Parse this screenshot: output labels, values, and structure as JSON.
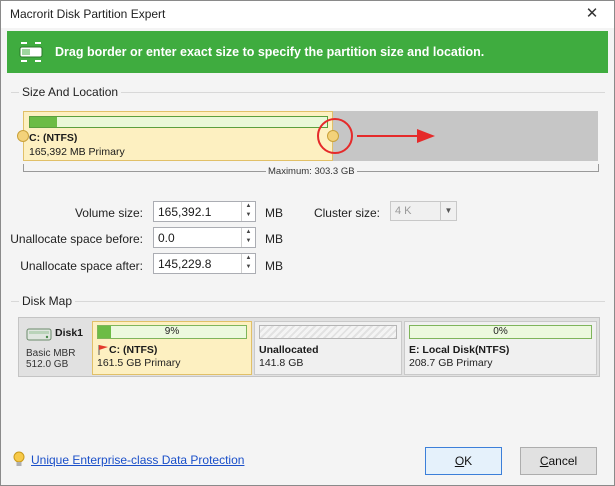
{
  "window": {
    "title": "Macrorit Disk Partition Expert",
    "close_glyph": "✕"
  },
  "banner": {
    "text": "Drag border or enter exact size to specify the partition size and location."
  },
  "size_location": {
    "group_label": "Size And Location",
    "partition_name": "C: (NTFS)",
    "partition_info": "165,392 MB Primary",
    "used_fraction": 0.09,
    "maximum_label": "Maximum: 303.3 GB"
  },
  "form": {
    "volume_size": {
      "label": "Volume size:",
      "value": "165,392.1",
      "unit": "MB"
    },
    "unalloc_before": {
      "label": "Unallocate space before:",
      "value": "0.0",
      "unit": "MB"
    },
    "unalloc_after": {
      "label": "Unallocate space after:",
      "value": "145,229.8",
      "unit": "MB"
    },
    "cluster_size": {
      "label": "Cluster size:",
      "value": "4 K"
    }
  },
  "disk_map": {
    "group_label": "Disk Map",
    "disk": {
      "name": "Disk1",
      "type": "Basic MBR",
      "size": "512.0 GB"
    },
    "segments": [
      {
        "pct": "9%",
        "fill": 0.09,
        "name": "C: (NTFS)",
        "info": "161.5 GB Primary"
      },
      {
        "pct": "",
        "fill": 0,
        "name": "Unallocated",
        "info": "141.8 GB"
      },
      {
        "pct": "0%",
        "fill": 0,
        "name": "E: Local Disk(NTFS)",
        "info": "208.7 GB Primary"
      }
    ]
  },
  "footer": {
    "link": "Unique Enterprise-class Data Protection",
    "ok_label": "OK",
    "ok_accel": "O",
    "ok_rest": "K",
    "cancel_label": "Cancel",
    "cancel_accel": "C",
    "cancel_rest": "ancel"
  },
  "colors": {
    "banner": "#3fac3f",
    "partition_fill": "#fdf0c1",
    "usage_bar": "#6cbc45",
    "highlight": "#e52a2a",
    "link": "#1a4fc9"
  }
}
